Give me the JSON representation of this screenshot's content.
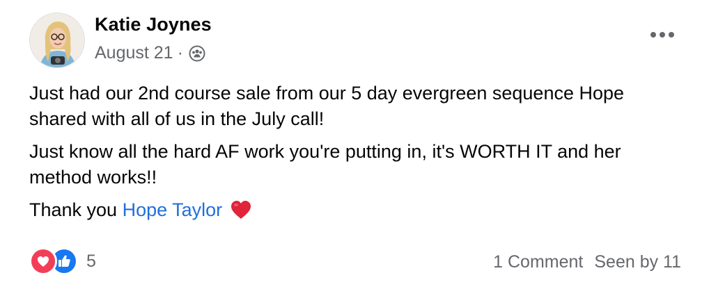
{
  "post": {
    "author": "Katie Joynes",
    "date": "August 21",
    "date_separator": "·",
    "privacy_icon": "group-members-icon",
    "more_icon": "more-options-icon"
  },
  "content": {
    "paragraph_1": "Just had our 2nd course sale from our 5 day evergreen sequence Hope shared with all of us in the July call!",
    "paragraph_2": "Just know all the hard AF work you're putting in, it's WORTH IT and her method works!!",
    "thanks_prefix": "Thank you ",
    "mention": "Hope Taylor",
    "emoji": "red-heart"
  },
  "footer": {
    "reaction_icons": [
      "love-reaction-icon",
      "like-reaction-icon"
    ],
    "reaction_count": "5",
    "comments": "1 Comment",
    "seen_by": "Seen by 11"
  },
  "colors": {
    "text": "#050505",
    "secondary": "#65676b",
    "link": "#216fdb",
    "love": "#f33e58",
    "like": "#1877f2"
  }
}
